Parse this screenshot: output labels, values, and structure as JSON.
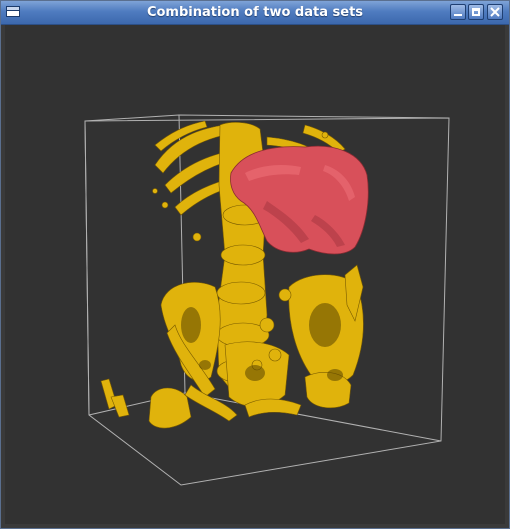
{
  "window": {
    "title": "Combination of two data sets"
  },
  "colors": {
    "titlebar": "#4f7cc0",
    "background": "#323232",
    "bone": "#e0b30c",
    "organ": "#d8505a",
    "box": "#c8c8c8"
  },
  "icons": {
    "window_menu": "window-icon",
    "minimize": "minimize-icon",
    "maximize": "maximize-icon",
    "close": "close-icon"
  }
}
